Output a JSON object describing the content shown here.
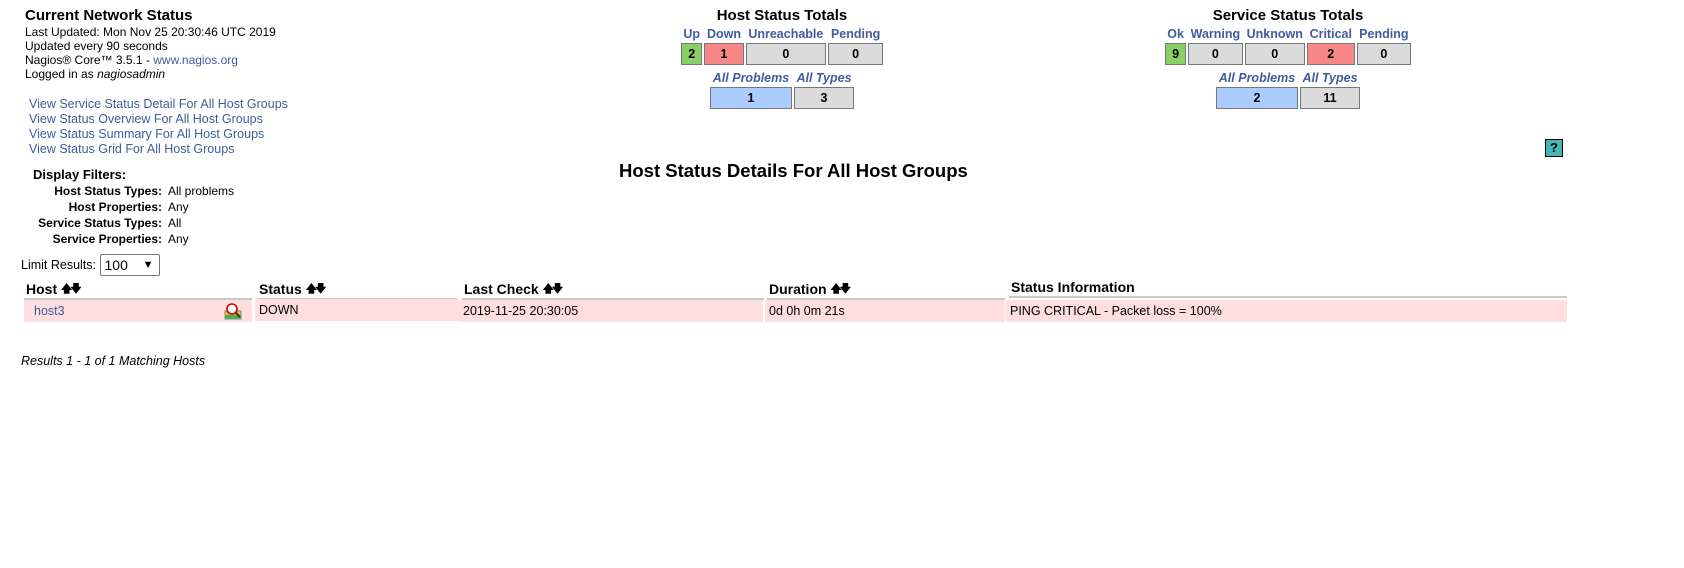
{
  "info": {
    "title": "Current Network Status",
    "last_updated": "Last Updated: Mon Nov 25 20:30:46 UTC 2019",
    "update_interval": "Updated every 90 seconds",
    "core_prefix": "Nagios® Core™ 3.5.1 - ",
    "core_link": "www.nagios.org",
    "logged_prefix": "Logged in as ",
    "user": "nagiosadmin"
  },
  "links": [
    "View Service Status Detail For All Host Groups",
    "View Status Overview For All Host Groups",
    "View Status Summary For All Host Groups",
    "View Status Grid For All Host Groups"
  ],
  "host_totals": {
    "title": "Host Status Totals",
    "headers": [
      "Up",
      "Down",
      "Unreachable",
      "Pending"
    ],
    "values": [
      "2",
      "1",
      "0",
      "0"
    ],
    "sub_headers": [
      "All Problems",
      "All Types"
    ],
    "sub_values": [
      "1",
      "3"
    ]
  },
  "service_totals": {
    "title": "Service Status Totals",
    "headers": [
      "Ok",
      "Warning",
      "Unknown",
      "Critical",
      "Pending"
    ],
    "values": [
      "9",
      "0",
      "0",
      "2",
      "0"
    ],
    "sub_headers": [
      "All Problems",
      "All Types"
    ],
    "sub_values": [
      "2",
      "11"
    ]
  },
  "help_icon": "?",
  "filters": {
    "title": "Display Filters:",
    "rows": [
      {
        "label": "Host Status Types:",
        "value": "All problems"
      },
      {
        "label": "Host Properties:",
        "value": "Any"
      },
      {
        "label": "Service Status Types:",
        "value": "All"
      },
      {
        "label": "Service Properties:",
        "value": "Any"
      }
    ]
  },
  "page_title": "Host Status Details For All Host Groups",
  "limit": {
    "label": "Limit Results:",
    "value": "100"
  },
  "table": {
    "columns": [
      "Host",
      "Status",
      "Last Check",
      "Duration",
      "Status Information"
    ],
    "rows": [
      {
        "host": "host3",
        "status": "DOWN",
        "last_check": "2019-11-25 20:30:05",
        "duration": "0d 0h 0m 21s",
        "info": "PING CRITICAL - Packet loss = 100%"
      }
    ]
  },
  "results_text": "Results 1 - 1 of 1 Matching Hosts",
  "colors": {
    "up": "#88d066",
    "down": "#f88888",
    "neutral": "#dbdbdb",
    "summary": "#aaccff",
    "row_bg": "#fedede",
    "link": "#3f5c9e"
  }
}
